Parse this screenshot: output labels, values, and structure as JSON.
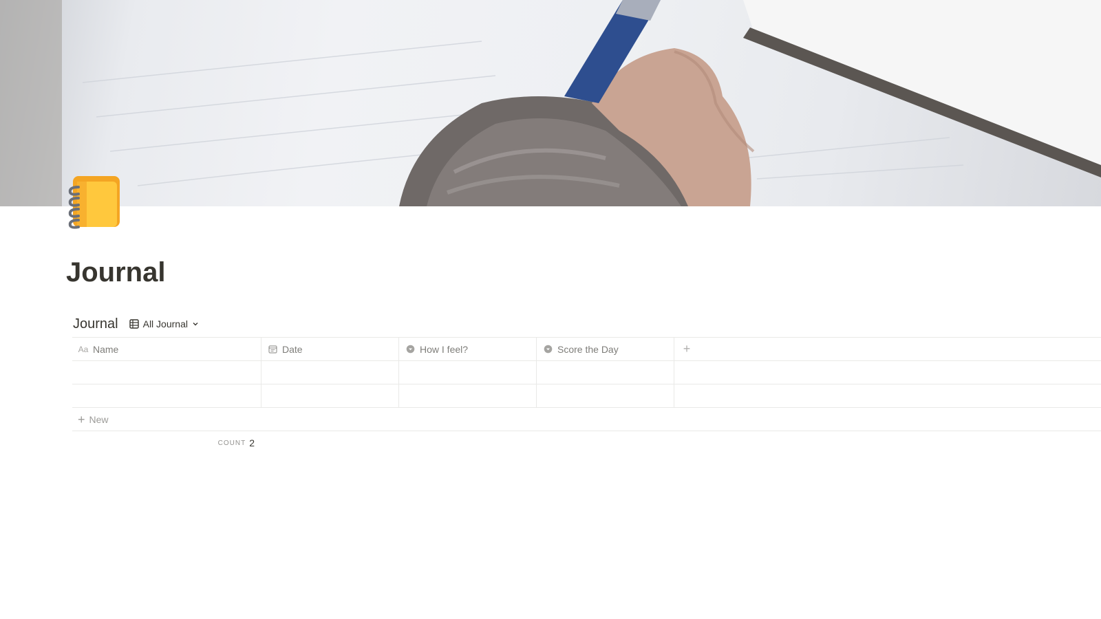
{
  "page": {
    "title": "Journal",
    "icon": "spiral-notebook-icon",
    "cover": "writing-hand-photo"
  },
  "database": {
    "title": "Journal",
    "view": {
      "icon": "table-icon",
      "label": "All Journal",
      "chevron": "chevron-down-icon"
    },
    "columns": [
      {
        "label": "Name",
        "icon": "text-aa-icon"
      },
      {
        "label": "Date",
        "icon": "calendar-icon"
      },
      {
        "label": "How I feel?",
        "icon": "select-icon"
      },
      {
        "label": "Score the Day",
        "icon": "select-icon"
      }
    ],
    "add_column_label": "+",
    "rows": [
      {
        "name": "",
        "date": "",
        "feel": "",
        "score": ""
      },
      {
        "name": "",
        "date": "",
        "feel": "",
        "score": ""
      }
    ],
    "new_row_label": "New",
    "footer": {
      "count_label": "COUNT",
      "count_value": "2"
    }
  },
  "colors": {
    "text": "#37352f",
    "border": "#e9e9e7",
    "icon_orange": "#f4a523",
    "icon_yellow": "#ffc83d"
  }
}
